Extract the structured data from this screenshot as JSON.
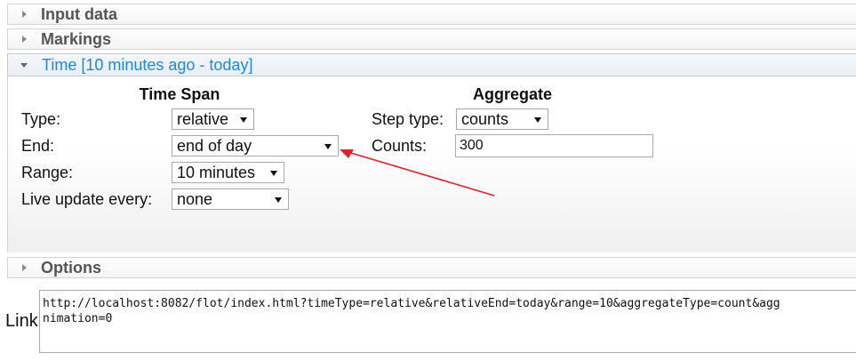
{
  "accordion": {
    "input_data": "Input data",
    "markings": "Markings",
    "time": "Time [10 minutes ago - today]",
    "options": "Options"
  },
  "time_span": {
    "title": "Time Span",
    "type_label": "Type:",
    "type_value": "relative",
    "end_label": "End:",
    "end_value": "end of day",
    "range_label": "Range:",
    "range_value": "10 minutes",
    "live_label": "Live update every:",
    "live_value": "none"
  },
  "aggregate": {
    "title": "Aggregate",
    "step_type_label": "Step type:",
    "step_type_value": "counts",
    "counts_label": "Counts:",
    "counts_value": "300"
  },
  "link": {
    "label": "Link",
    "line1": "http://localhost:8082/flot/index.html?timeType=relative&relativeEnd=today&range=10&aggregateType=count&agg",
    "line2": "nimation=0"
  },
  "colors": {
    "active_header": "#1e88e5",
    "annotation_arrow": "#d9252b"
  }
}
